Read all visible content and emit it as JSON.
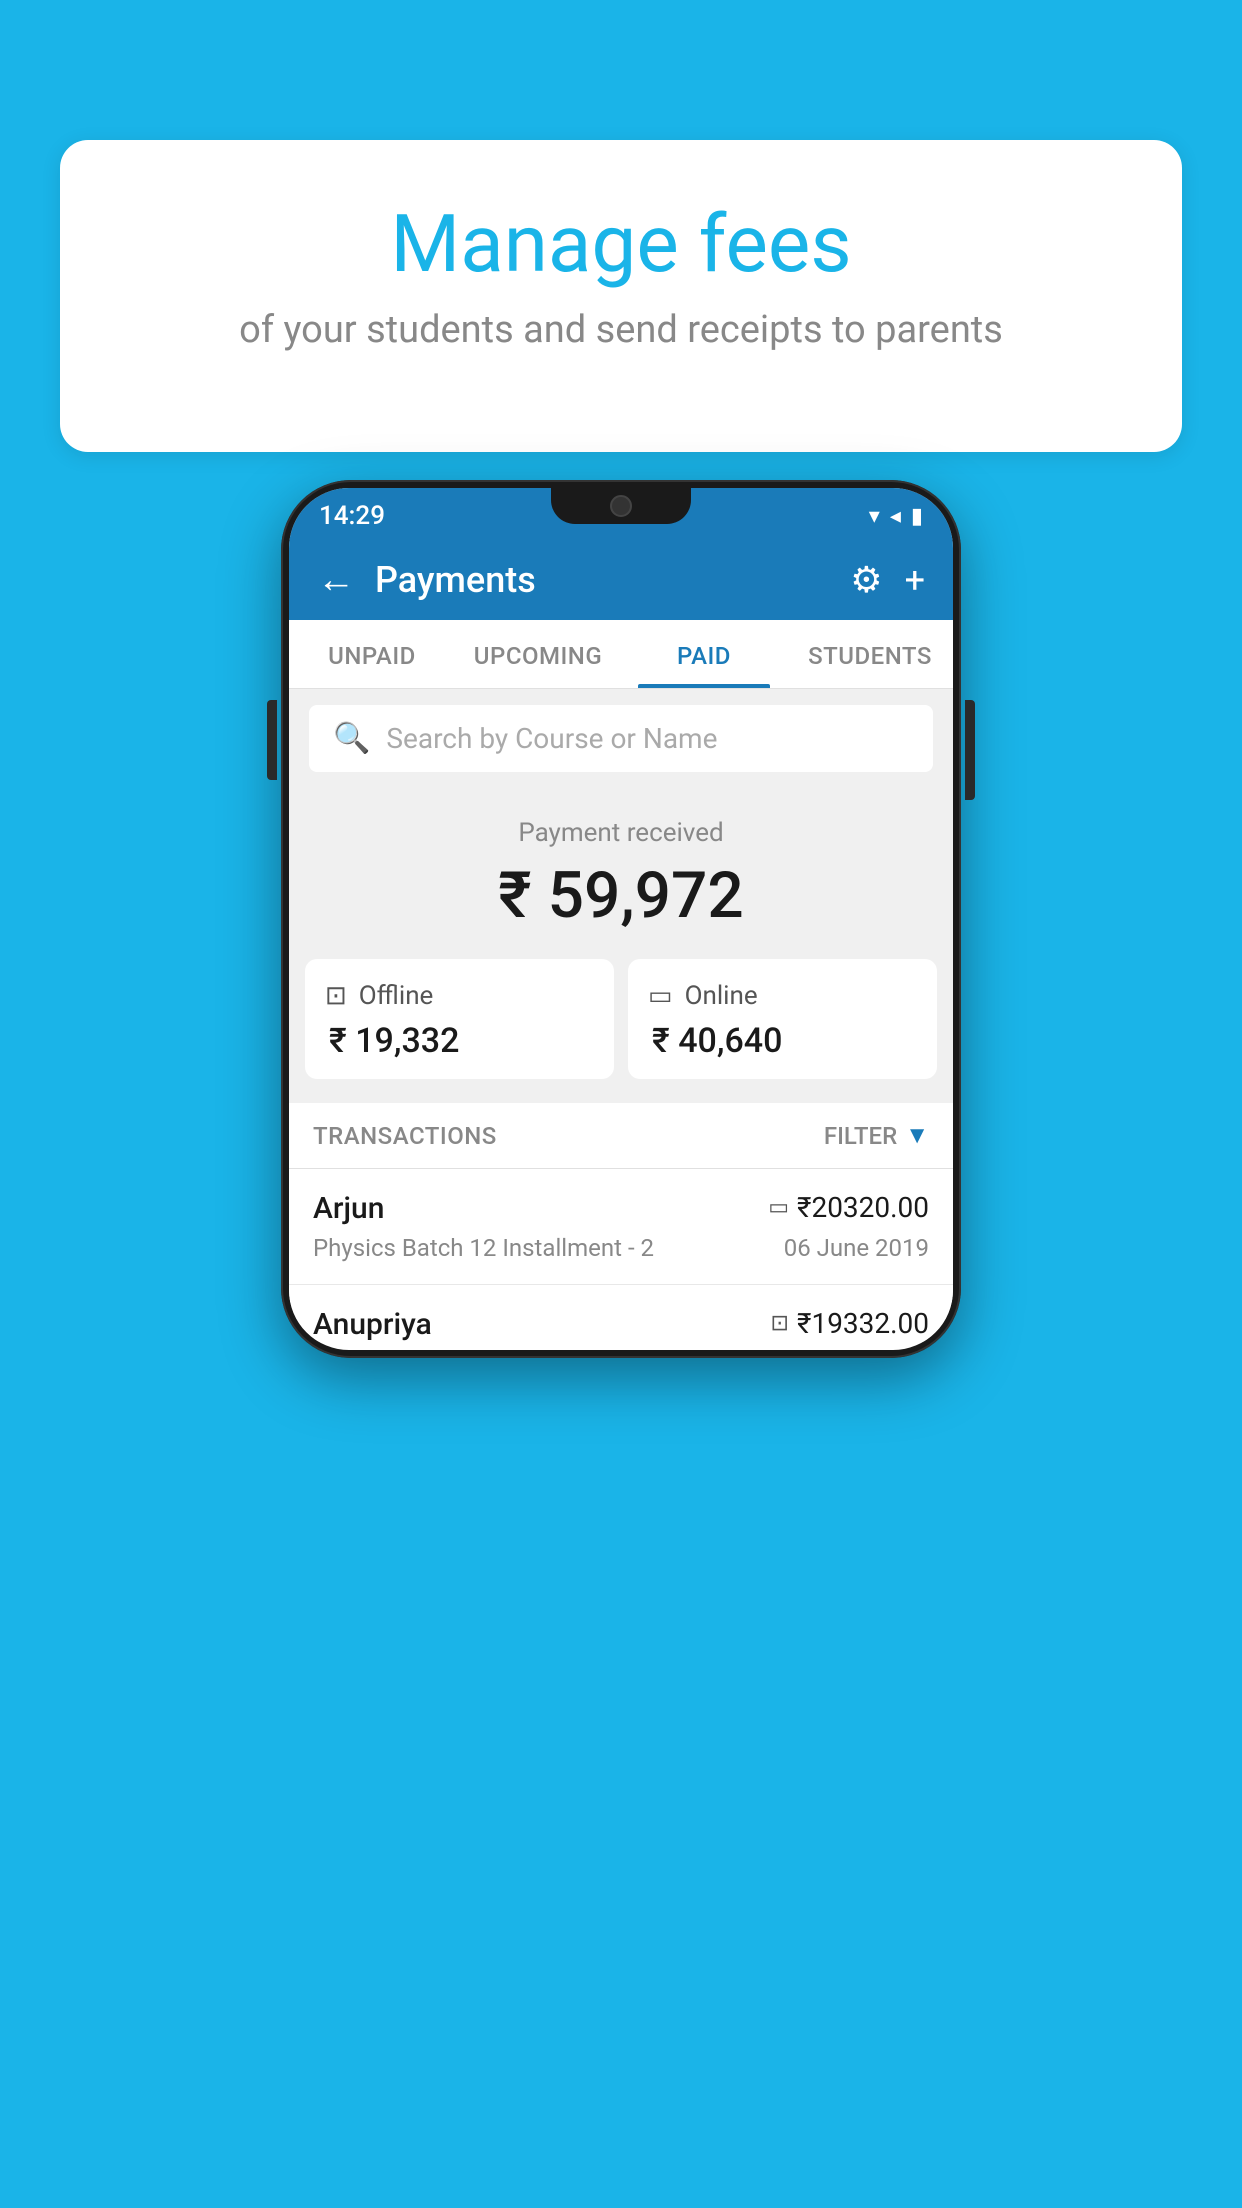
{
  "background_color": "#1ab4e8",
  "speech_bubble": {
    "title": "Manage fees",
    "subtitle": "of your students and send receipts to parents"
  },
  "status_bar": {
    "time": "14:29",
    "wifi": "▼",
    "signal": "▲",
    "battery": "▮"
  },
  "header": {
    "title": "Payments",
    "back_label": "←",
    "settings_label": "⚙",
    "add_label": "+"
  },
  "tabs": [
    {
      "label": "UNPAID",
      "active": false
    },
    {
      "label": "UPCOMING",
      "active": false
    },
    {
      "label": "PAID",
      "active": true
    },
    {
      "label": "STUDENTS",
      "active": false
    }
  ],
  "search": {
    "placeholder": "Search by Course or Name"
  },
  "payment_summary": {
    "label": "Payment received",
    "amount": "₹ 59,972",
    "offline": {
      "type": "Offline",
      "amount": "₹ 19,332"
    },
    "online": {
      "type": "Online",
      "amount": "₹ 40,640"
    }
  },
  "transactions": {
    "header_label": "TRANSACTIONS",
    "filter_label": "FILTER",
    "items": [
      {
        "name": "Arjun",
        "amount": "₹20320.00",
        "course": "Physics Batch 12 Installment - 2",
        "date": "06 June 2019",
        "payment_type": "online"
      },
      {
        "name": "Anupriya",
        "amount": "₹19332.00",
        "course": "",
        "date": "",
        "payment_type": "offline"
      }
    ]
  }
}
